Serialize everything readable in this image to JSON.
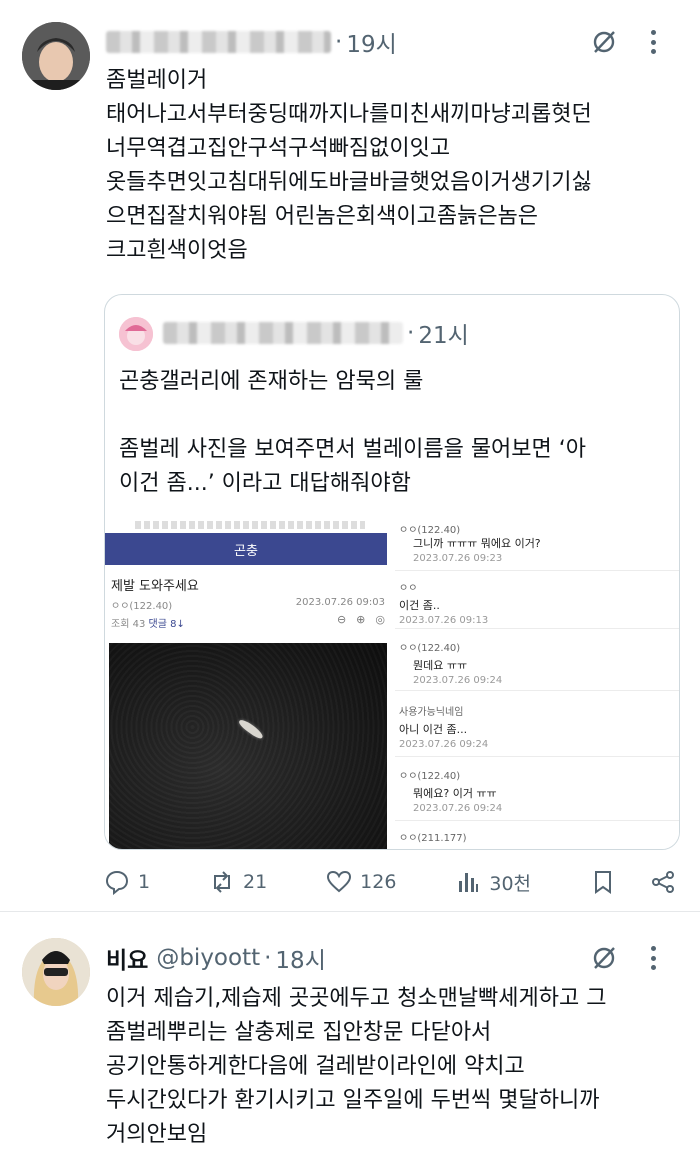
{
  "tweet1": {
    "time": "19시",
    "text": "좀벌레이거\n태어나고서부터중딩때까지나를미친새끼마냥괴롭혓던\n너무역겹고집안구석구석빠짐없이잇고\n옷들추면잇고침대뒤에도바글바글햇었음이거생기기싫\n으면집잘치워야됨 어린놈은회색이고좀늙은놈은\n크고흰색이엇음",
    "quote": {
      "time": "21시",
      "text": "곤충갤러리에 존재하는 암묵의 룰\n\n좀벌레 사진을 보여주면서 벌레이름을 물어보면 ‘아\n이건 좀...’ 이라고 대답해줘야함",
      "screenshot": {
        "gallery_title": "곤충",
        "post_title": "제발 도와주세요",
        "post_author": "ㅇㅇ(122.40)",
        "post_date": "2023.07.26 09:03",
        "post_views": "조회 43",
        "post_comments": "댓글 8↓",
        "comments": [
          {
            "who": "ㅇㅇ(122.40)",
            "text": "그니까 ㅠㅠㅠ 뭐에요 이거?",
            "date": "2023.07.26 09:23"
          },
          {
            "who": "ㅇㅇ",
            "text": "이건 좀..",
            "date": "2023.07.26 09:13"
          },
          {
            "who": "ㅇㅇ(122.40)",
            "text": "뭔데요 ㅠㅠ",
            "date": "2023.07.26 09:24"
          },
          {
            "who": "사용가능닉네임",
            "text": "아니 이건 좀...",
            "date": "2023.07.26 09:24"
          },
          {
            "who": "ㅇㅇ(122.40)",
            "text": "뭐에요? 이거 ㅠㅠ",
            "date": "2023.07.26 09:24"
          },
          {
            "who": "ㅇㅇ(211.177)",
            "text": "",
            "date": ""
          }
        ]
      }
    },
    "actions": {
      "replies": "1",
      "retweets": "21",
      "likes": "126",
      "views": "30천"
    }
  },
  "tweet2": {
    "name": "비요",
    "handle": "@biyoott",
    "time": "18시",
    "text": "이거 제습기,제습제 곳곳에두고 청소맨날빡세게하고 그\n좀벌레뿌리는 살충제로 집안창문 다닫아서\n공기안통하게한다음에 걸레받이라인에 약치고\n두시간있다가 환기시키고 일주일에 두번씩 몇달하니까\n거의안보임"
  },
  "icons": [
    "grok-icon",
    "more-icon",
    "reply-icon",
    "retweet-icon",
    "like-icon",
    "views-icon",
    "bookmark-icon",
    "share-icon"
  ]
}
